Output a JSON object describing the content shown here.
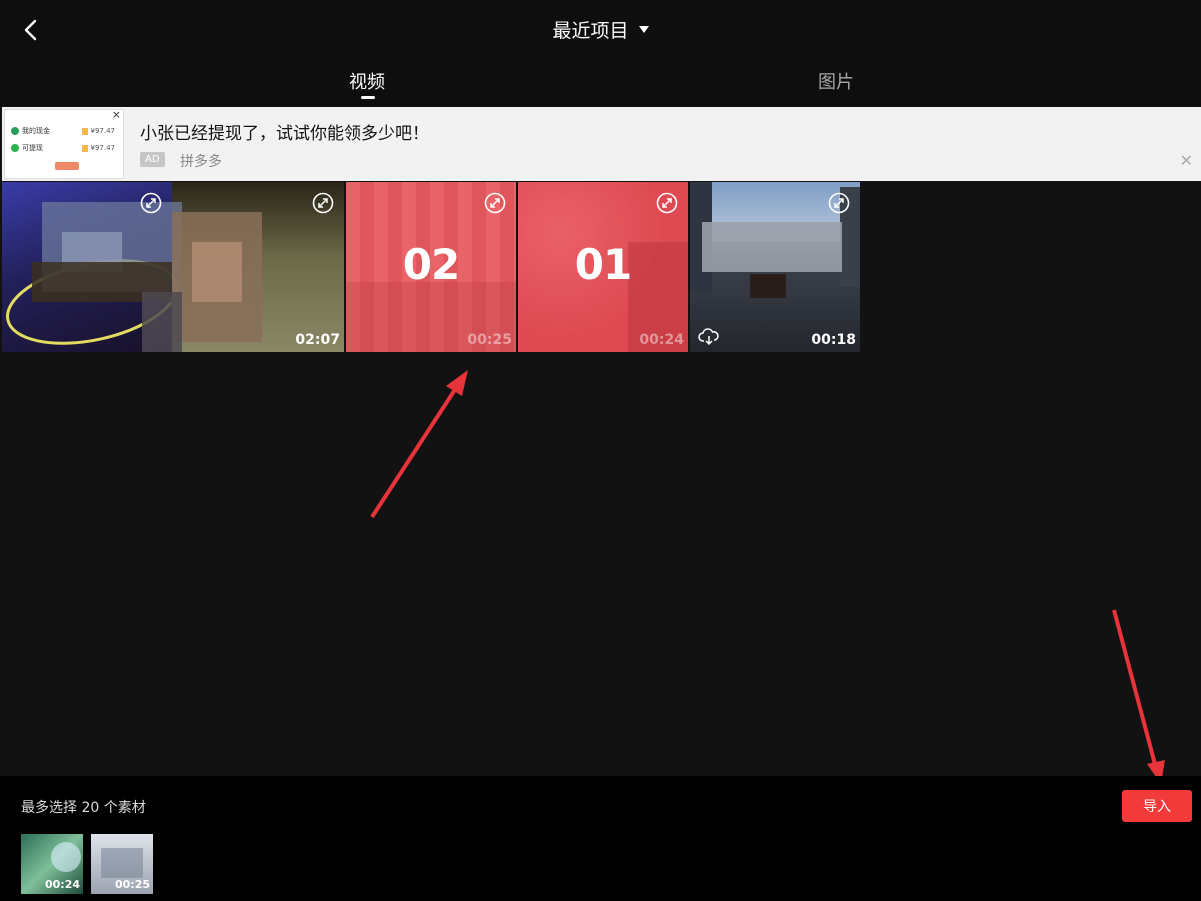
{
  "header": {
    "title": "最近项目"
  },
  "tabs": [
    {
      "label": "视频",
      "active": true
    },
    {
      "label": "图片",
      "active": false
    }
  ],
  "ad": {
    "title": "小张已经提现了，试试你能领多少吧！",
    "badge": "AD",
    "source": "拼多多",
    "thumb_rows": [
      {
        "label": "我的现金",
        "price": "¥97.47"
      },
      {
        "label": "可提现",
        "price": "¥97.47"
      }
    ]
  },
  "media": [
    {
      "duration": "02:07"
    },
    {
      "label": "02",
      "duration": "00:25"
    },
    {
      "label": "01",
      "duration": "00:24"
    },
    {
      "duration": "00:18",
      "cloud": true
    }
  ],
  "bottom": {
    "limit_text": "最多选择 20 个素材",
    "import_label": "导入",
    "selected": [
      {
        "duration": "00:24"
      },
      {
        "duration": "00:25"
      }
    ]
  },
  "colors": {
    "accent": "#f23a3a",
    "tile_red": "#e85a5f",
    "background": "#121212"
  }
}
